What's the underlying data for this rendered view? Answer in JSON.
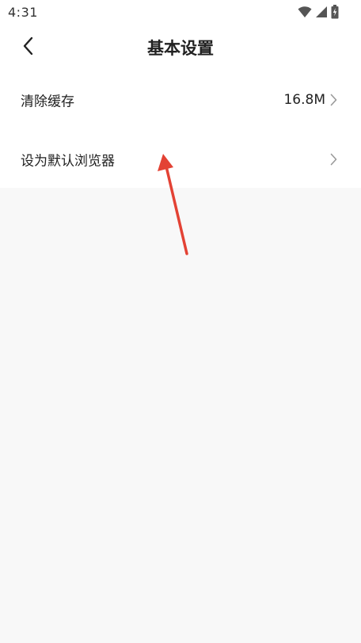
{
  "status_bar": {
    "time": "4:31",
    "icons": [
      "wifi-icon",
      "cellular-signal-icon",
      "battery-charging-icon"
    ]
  },
  "nav": {
    "title": "基本设置",
    "back_icon": "chevron-left-icon"
  },
  "settings": {
    "items": [
      {
        "label": "清除缓存",
        "value": "16.8M",
        "icon": "chevron-right-icon"
      },
      {
        "label": "设为默认浏览器",
        "value": "",
        "icon": "chevron-right-icon"
      }
    ]
  },
  "annotation": {
    "color": "#e34234",
    "icon": "red-arrow-annotation"
  },
  "colors": {
    "background": "#f8f8f8",
    "surface": "#ffffff",
    "text": "#222222",
    "chevron": "#9a9a9a"
  }
}
